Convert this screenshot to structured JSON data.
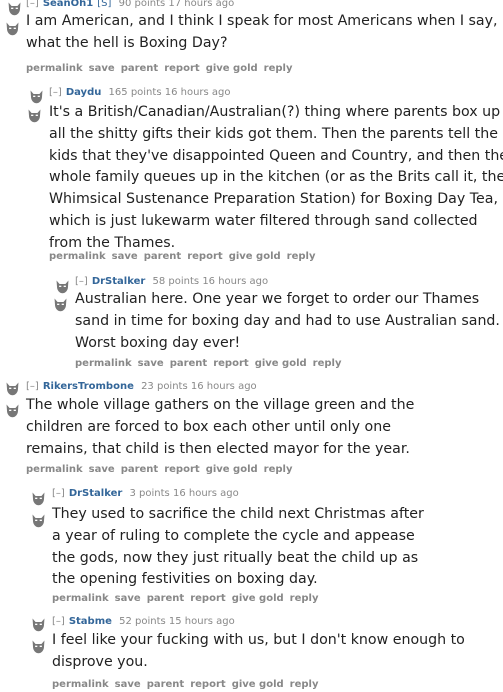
{
  "comments": [
    {
      "toggle": "[–]",
      "author": "SeanOh1",
      "flair": "[S]",
      "score": "90 points",
      "time": "17 hours ago",
      "lines": [
        "I am American, and I think I speak for most Americans when I say,",
        "what the hell is Boxing Day?"
      ]
    },
    {
      "toggle": "[–]",
      "author": "Daydu",
      "score": "165 points",
      "time": "16 hours ago",
      "lines": [
        "It's a British/Canadian/Australian(?) thing where parents box up",
        "all the shitty gifts their kids got them. Then the parents tell the",
        "kids that they've disappointed Queen and Country, and then the",
        "whole family queues up in the kitchen (or as the Brits call it, the",
        "Whimsical Sustenance Preparation Station) for Boxing Day Tea,",
        "which is just lukewarm water filtered through sand collected",
        "from the Thames."
      ]
    },
    {
      "toggle": "[–]",
      "author": "DrStalker",
      "score": "58 points",
      "time": "16 hours ago",
      "lines": [
        "Australian here. One year we forget to order our Thames",
        "sand in time for boxing day and had to use Australian sand.",
        "Worst boxing day ever!"
      ]
    },
    {
      "toggle": "[–]",
      "author": "RikersTrombone",
      "score": "23 points",
      "time": "16 hours ago",
      "lines": [
        "The whole village gathers on the village green and the",
        "children are forced to box each other until only one",
        "remains, that child is then elected mayor for the year."
      ]
    },
    {
      "toggle": "[–]",
      "author": "DrStalker",
      "score": "3 points",
      "time": "16 hours ago",
      "lines": [
        "They used to sacrifice the child next Christmas after",
        "a year of ruling to complete the cycle and appease",
        "the gods, now they just ritually beat the child up as",
        "the opening festivities on boxing day."
      ]
    },
    {
      "toggle": "[–]",
      "author": "Stabme",
      "score": "52 points",
      "time": "15 hours ago",
      "lines": [
        "I feel like your fucking with us, but I don't know enough to",
        "disprove you."
      ]
    }
  ],
  "buttons": {
    "permalink": "permalink",
    "save": "save",
    "parent": "parent",
    "report": "report",
    "give_gold": "give gold",
    "reply": "reply"
  },
  "icons": {
    "avatar": "snoo-avatar-icon"
  },
  "colors": {
    "author": "#336699",
    "meta": "#888888",
    "text": "#222222"
  }
}
